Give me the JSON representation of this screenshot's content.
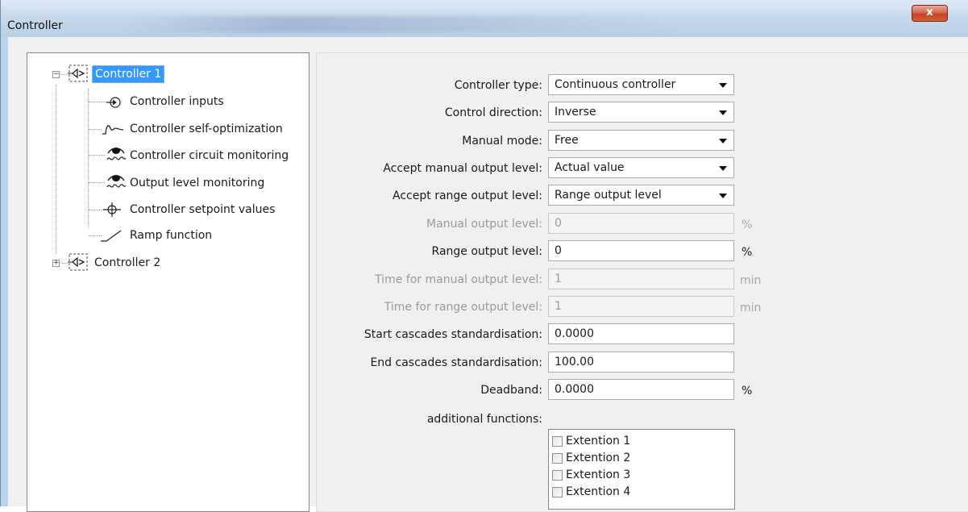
{
  "window": {
    "title": "Controller",
    "close_glyph": "x"
  },
  "tree": {
    "nodes": [
      {
        "label": "Controller 1",
        "expander": "−",
        "icon": "controller-block-icon"
      },
      {
        "label": "Controller inputs",
        "icon": "controller-inputs-icon"
      },
      {
        "label": "Controller self-optimization",
        "icon": "self-optimization-wave-icon"
      },
      {
        "label": "Controller circuit monitoring",
        "icon": "circuit-monitoring-eye-icon"
      },
      {
        "label": "Output level monitoring",
        "icon": "output-monitoring-eye-icon"
      },
      {
        "label": "Controller setpoint values",
        "icon": "setpoint-crosshair-icon"
      },
      {
        "label": "Ramp function",
        "icon": "ramp-icon"
      },
      {
        "label": "Controller 2",
        "expander": "+",
        "icon": "controller-block-icon"
      }
    ]
  },
  "form": {
    "controller_type": {
      "label": "Controller type:",
      "value": "Continuous controller"
    },
    "control_direction": {
      "label": "Control direction:",
      "value": "Inverse"
    },
    "manual_mode": {
      "label": "Manual mode:",
      "value": "Free"
    },
    "accept_manual": {
      "label": "Accept manual output level:",
      "value": "Actual value"
    },
    "accept_range": {
      "label": "Accept range output level:",
      "value": "Range output level"
    },
    "manual_output": {
      "label": "Manual output level:",
      "value": "0",
      "unit": "%"
    },
    "range_output": {
      "label": "Range output level:",
      "value": "0",
      "unit": "%"
    },
    "time_manual": {
      "label": "Time for manual output level:",
      "value": "1",
      "unit": "min"
    },
    "time_range": {
      "label": "Time for range output level:",
      "value": "1",
      "unit": "min"
    },
    "start_cascades": {
      "label": "Start cascades standardisation:",
      "value": "0.0000"
    },
    "end_cascades": {
      "label": "End cascades standardisation:",
      "value": "100.00"
    },
    "deadband": {
      "label": "Deadband:",
      "value": "0.0000",
      "unit": "%"
    },
    "additional": {
      "label": "additional functions:",
      "items": [
        "Extention 1",
        "Extention 2",
        "Extention 3",
        "Extention 4"
      ]
    }
  }
}
